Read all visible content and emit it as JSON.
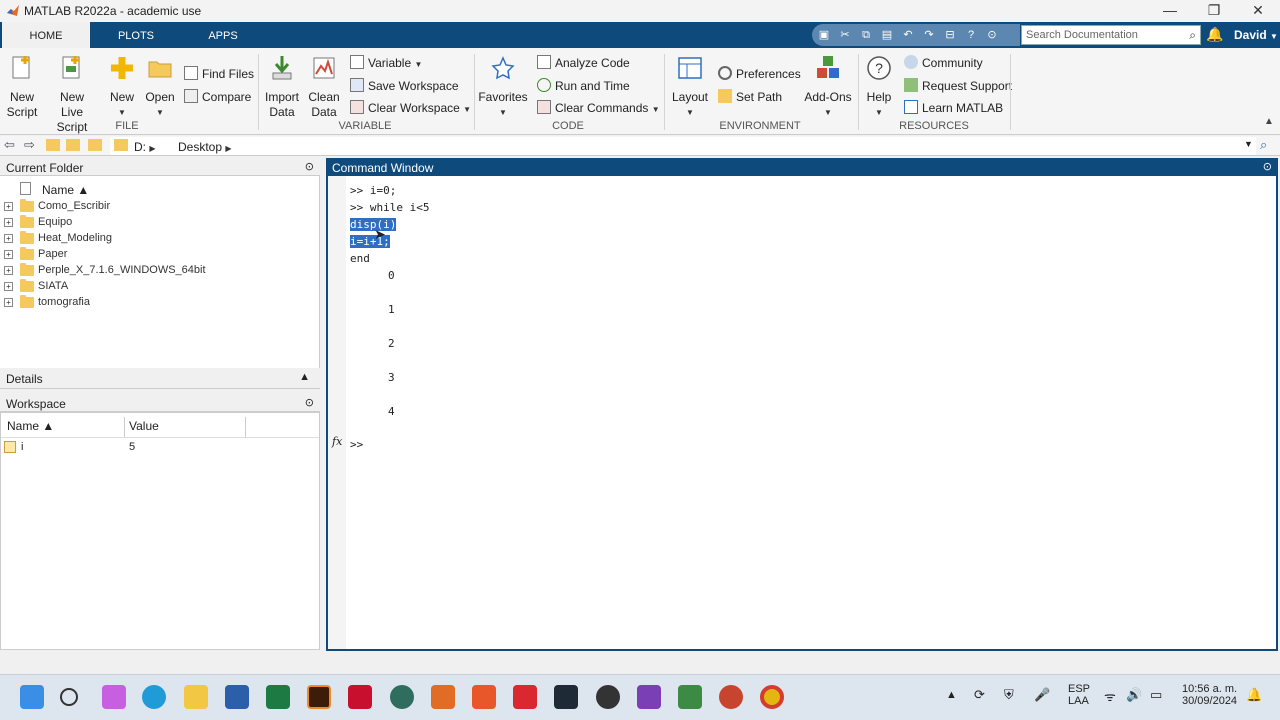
{
  "window": {
    "title": "MATLAB R2022a - academic use",
    "min": "—",
    "max": "❐",
    "close": "✕"
  },
  "tabs": [
    {
      "label": "HOME"
    },
    {
      "label": "PLOTS"
    },
    {
      "label": "APPS"
    }
  ],
  "search": {
    "placeholder": "Search Documentation"
  },
  "user": "David",
  "ribbon": {
    "file": {
      "new_script": [
        "New",
        "Script"
      ],
      "new_live": [
        "New",
        "Live Script"
      ],
      "new": "New",
      "open": "Open",
      "find_files": "Find Files",
      "compare": "Compare",
      "group": "FILE"
    },
    "variable": {
      "import": [
        "Import",
        "Data"
      ],
      "clean": [
        "Clean",
        "Data"
      ],
      "variable": "Variable",
      "save_ws": "Save Workspace",
      "clear_ws": "Clear Workspace",
      "group": "VARIABLE"
    },
    "code": {
      "favorites": "Favorites",
      "analyze": "Analyze Code",
      "run_time": "Run and Time",
      "clear_cmds": "Clear Commands",
      "group": "CODE"
    },
    "environment": {
      "layout": "Layout",
      "preferences": "Preferences",
      "set_path": "Set Path",
      "addons": "Add-Ons",
      "group": "ENVIRONMENT"
    },
    "resources": {
      "help": "Help",
      "community": "Community",
      "request_support": "Request Support",
      "learn": "Learn MATLAB",
      "group": "RESOURCES"
    }
  },
  "address": {
    "drive": "D:",
    "folder": "Desktop"
  },
  "current_folder": {
    "title": "Current Folder",
    "col_name": "Name ▲",
    "items": [
      "Como_Escribir",
      "Equipo",
      "Heat_Modeling",
      "Paper",
      "Perple_X_7.1.6_WINDOWS_64bit",
      "SIATA",
      "tomografia"
    ]
  },
  "details": {
    "title": "Details"
  },
  "workspace": {
    "title": "Workspace",
    "col_name": "Name ▲",
    "col_value": "Value",
    "rows": [
      {
        "name": "i",
        "value": "5"
      }
    ]
  },
  "command_window": {
    "title": "Command Window",
    "lines": [
      ">> i=0;",
      ">> while i<5",
      "disp(i)",
      "i=i+1;",
      "end"
    ],
    "outputs": [
      "0",
      "1",
      "2",
      "3",
      "4"
    ],
    "prompt": ">>",
    "fx": "fx"
  },
  "taskbar": {
    "lang1": "ESP",
    "lang2": "LAA",
    "time": "10:56 a. m.",
    "date": "30/09/2024"
  },
  "colors": {
    "matlab_blue": "#0f4a7c",
    "selection": "#2e6fc4"
  }
}
